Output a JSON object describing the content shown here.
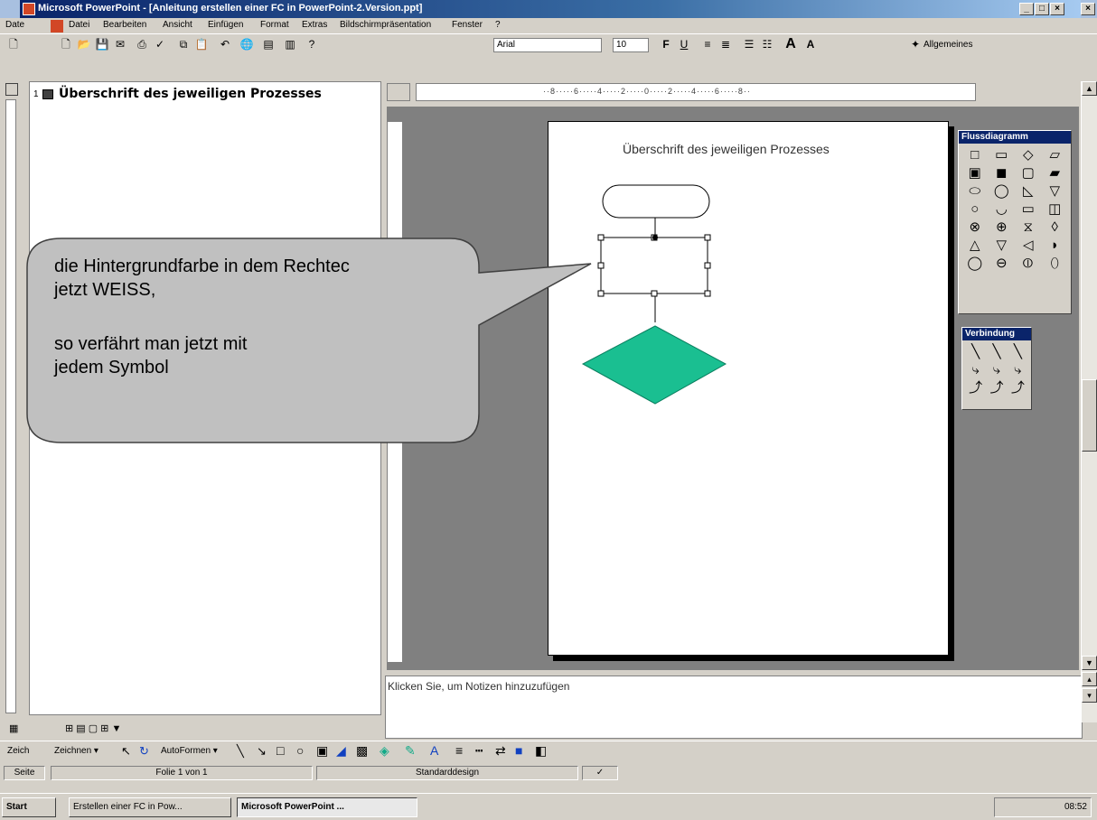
{
  "window": {
    "title": "Microsoft PowerPoint - [Anleitung erstellen einer FC in PowerPoint-2.Version.ppt]"
  },
  "menubar": {
    "left_label": "Date",
    "items": [
      "Datei",
      "Bearbeiten",
      "Ansicht",
      "Einfügen",
      "Format",
      "Extras",
      "Bildschirmpräsentation",
      "Fenster",
      "?"
    ]
  },
  "toolbar": {
    "font": "Arial",
    "size": "10",
    "style_menu": "Allgemeines"
  },
  "outline": {
    "slide_number": "1",
    "title": "Überschrift des jeweiligen Prozesses"
  },
  "slide": {
    "title": "Überschrift des jeweiligen Prozesses",
    "diamond_color": "#1abf91"
  },
  "ruler": {
    "top_text": "··8·····6·····4·····2·····0·····2·····4·····6·····8··"
  },
  "callout": {
    "line1": "die Hintergrundfarbe in dem Rechtec",
    "line2": "jetzt  WEISS,",
    "line3": "so verfährt man jetzt mit",
    "line4": "jedem Symbol"
  },
  "palettes": {
    "flow_title": "Flussdiagramm",
    "connect_title": "Verbindung",
    "flow_shapes": [
      "□",
      "▭",
      "◇",
      "▱",
      "▣",
      "◼",
      "▢",
      "▰",
      "⬭",
      "◯",
      "◺",
      "▽",
      "○",
      "◡",
      "▭",
      "◫",
      "⊗",
      "⊕",
      "⧖",
      "◊",
      "△",
      "▽",
      "◁",
      "◗",
      "◯",
      "⊖",
      "⦶",
      "⬯"
    ],
    "connect_shapes": [
      "╲",
      "╲",
      "╲",
      "⤷",
      "⤷",
      "⤷",
      "⤴",
      "⤴",
      "⤴"
    ]
  },
  "notes": {
    "placeholder": "Klicken Sie, um Notizen hinzuzufügen"
  },
  "drawbar": {
    "left_label": "Zeich",
    "draw": "Zeichnen ▾",
    "autoshapes": "AutoFormen ▾"
  },
  "statusbar": {
    "left_label": "Seite",
    "slide": "Folie 1 von 1",
    "design": "Standarddesign"
  },
  "taskbar": {
    "start": "Start",
    "task1": "Erstellen einer FC in Pow...",
    "task2": "Microsoft PowerPoint ...",
    "clock": "08:52"
  }
}
